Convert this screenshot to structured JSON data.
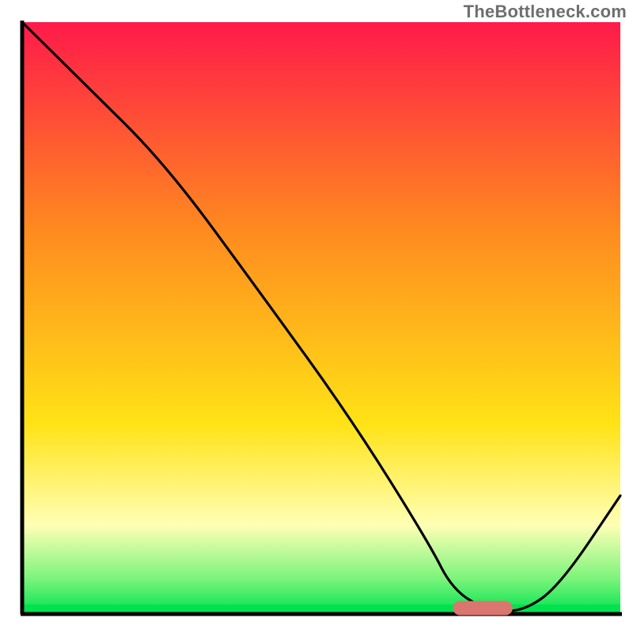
{
  "watermark": "TheBottleneck.com",
  "colors": {
    "axis": "#000000",
    "curve": "#000000",
    "marker_fill": "#d9766e",
    "gradient_top": "#ff1a4a",
    "gradient_mid_orange": "#ff8a1f",
    "gradient_yellow": "#ffe316",
    "gradient_pale_yellow": "#ffffb5",
    "gradient_green_light": "#7cf47c",
    "gradient_green": "#00e24f"
  },
  "chart_data": {
    "type": "line",
    "title": "",
    "xlabel": "",
    "ylabel": "",
    "xlim": [
      0,
      100
    ],
    "ylim": [
      0,
      100
    ],
    "series": [
      {
        "name": "bottleneck-curve",
        "x": [
          0,
          10,
          24,
          40,
          55,
          68,
          72,
          78,
          84,
          90,
          100
        ],
        "y": [
          100,
          90,
          76,
          54,
          33,
          12,
          4,
          0.5,
          0.5,
          5,
          20
        ]
      }
    ],
    "marker": {
      "name": "optimal-range",
      "x_start": 72,
      "x_end": 82,
      "y": 1
    },
    "gradient_stops_pct": [
      {
        "offset": 0,
        "key": "gradient_top"
      },
      {
        "offset": 35,
        "key": "gradient_mid_orange"
      },
      {
        "offset": 68,
        "key": "gradient_yellow"
      },
      {
        "offset": 85,
        "key": "gradient_pale_yellow"
      },
      {
        "offset": 94,
        "key": "gradient_green_light"
      },
      {
        "offset": 100,
        "key": "gradient_green"
      }
    ]
  }
}
